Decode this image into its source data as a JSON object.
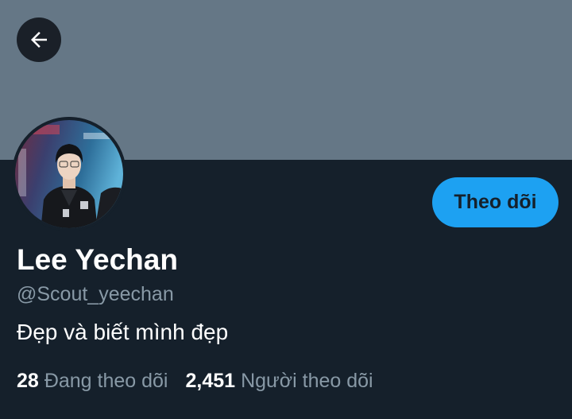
{
  "profile": {
    "name": "Lee Yechan",
    "handle": "@Scout_yeechan",
    "bio": "Đẹp và biết mình đẹp",
    "follow_button_label": "Theo dõi"
  },
  "stats": {
    "following_count": "28",
    "following_label": "Đang theo dõi",
    "followers_count": "2,451",
    "followers_label": "Người theo dõi"
  },
  "icons": {
    "back": "arrow-left-icon"
  },
  "colors": {
    "background": "#15202b",
    "banner": "#657786",
    "accent": "#1da1f2",
    "secondary_text": "#8899a6"
  }
}
